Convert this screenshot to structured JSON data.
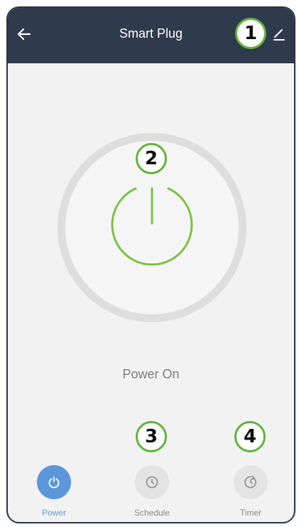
{
  "header": {
    "title": "Smart Plug"
  },
  "callouts": [
    "1",
    "2",
    "3",
    "4"
  ],
  "device": {
    "status": "Power On"
  },
  "tabs": [
    {
      "label": "Power",
      "active": true
    },
    {
      "label": "Schedule",
      "active": false
    },
    {
      "label": "Timer",
      "active": false
    }
  ],
  "colors": {
    "header_bg": "#2f3a4d",
    "power_ring": "#7cc242",
    "active_tab": "#5b97da",
    "callout_border": "#62b33b"
  }
}
